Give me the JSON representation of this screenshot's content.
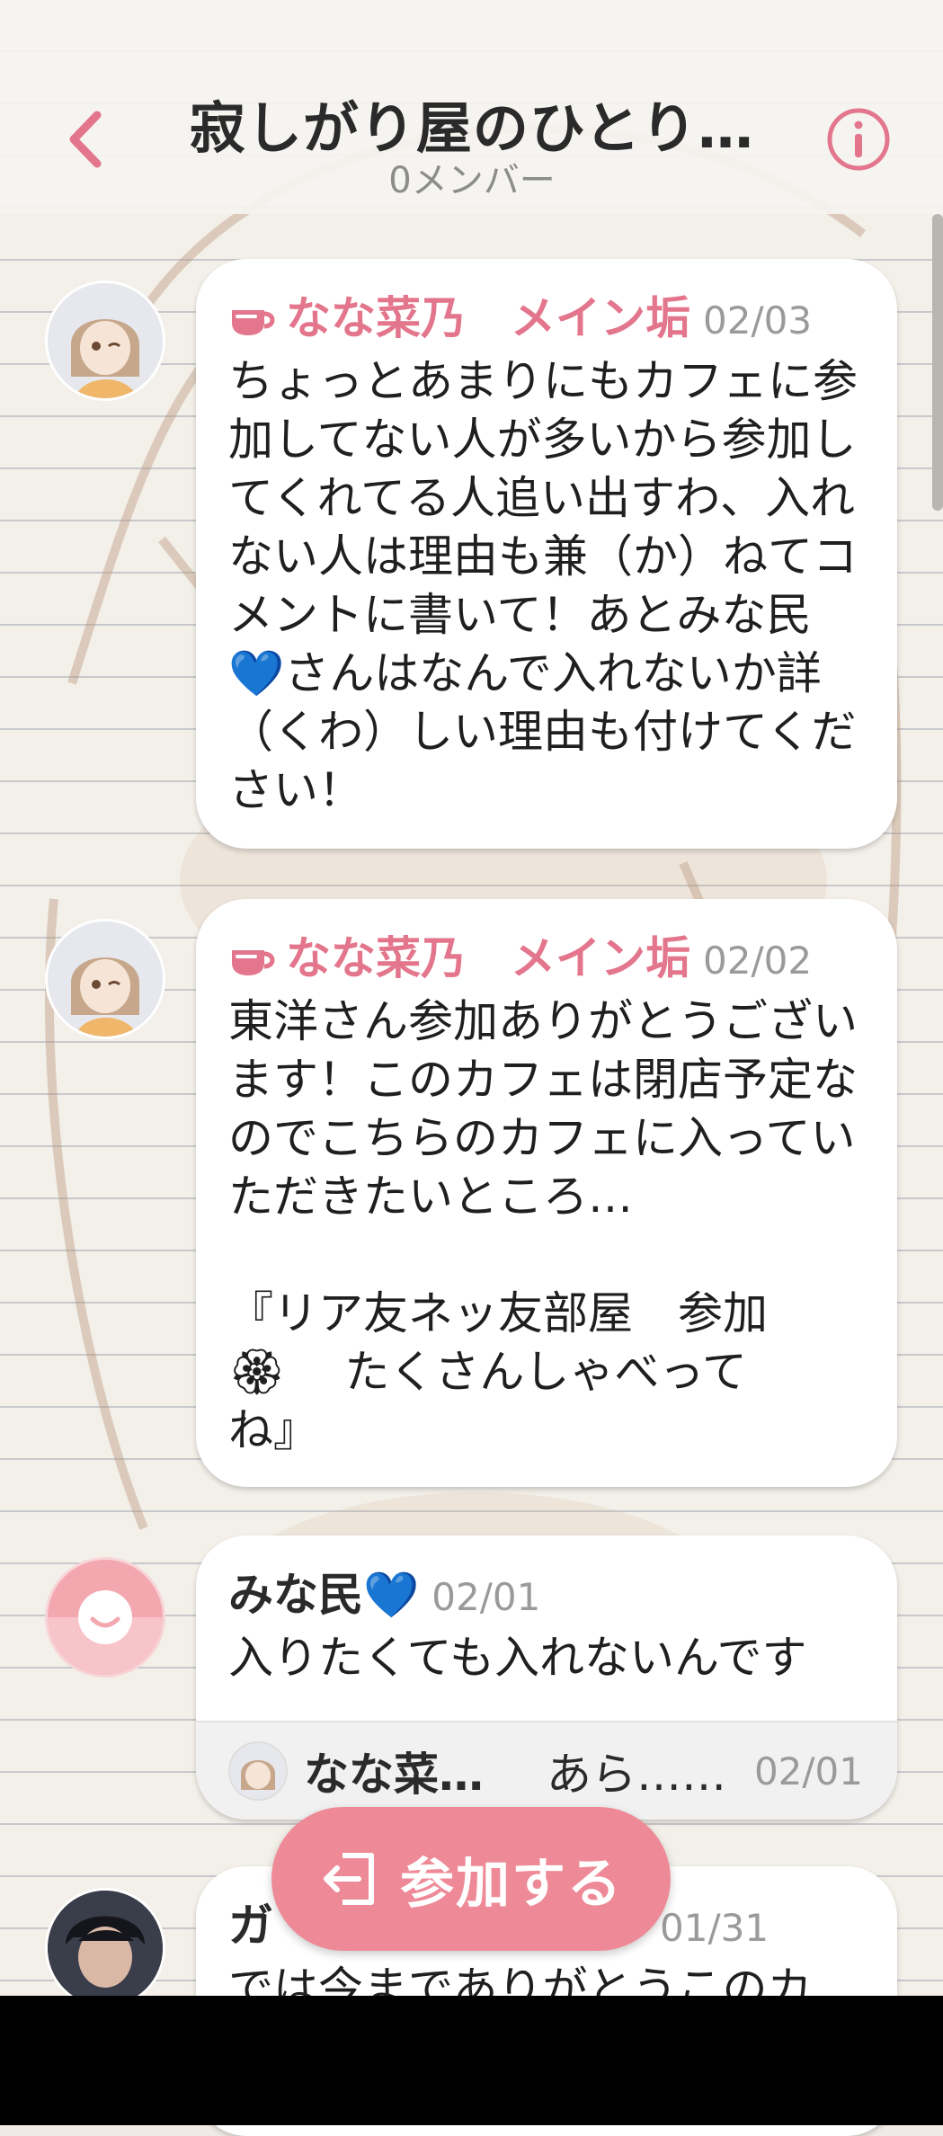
{
  "header": {
    "title": "寂しがり屋のひとり…",
    "subtitle": "0メンバー"
  },
  "messages": [
    {
      "sender": "なな菜乃　メイン垢",
      "date": "02/03",
      "text": "ちょっとあまりにもカフェに参加してない人が多いから参加してくれてる人追い出すわ、入れない人は理由も兼（か）ねてコメントに書いて！あとみな民💙さんはなんで入れないか詳（くわ）しい理由も付けてください！"
    },
    {
      "sender": "なな菜乃　メイン垢",
      "date": "02/02",
      "text": "東洋さん参加ありがとうございます！このカフェは閉店予定なのでこちらのカフェに入っていただきたいところ…\n\n『リア友ネッ友部屋　参加\n🏵　 たくさんしゃべって\nね』"
    },
    {
      "sender": "みな民💙",
      "date": "02/01",
      "text": "入りたくても入れないんです",
      "reply": {
        "name": "なな菜…",
        "text": "あら……",
        "date": "02/01"
      }
    },
    {
      "sender": "ガ",
      "date": "01/31",
      "text": "では今までありがとうこのカ"
    }
  ],
  "join_button": {
    "label": "参加する"
  },
  "icons": {
    "back": "chevron-left-icon",
    "info": "info-icon",
    "cup": "coffee-cup-icon",
    "join": "enter-icon"
  },
  "colors": {
    "accent": "#e3768c",
    "button": "#ee8a97"
  }
}
